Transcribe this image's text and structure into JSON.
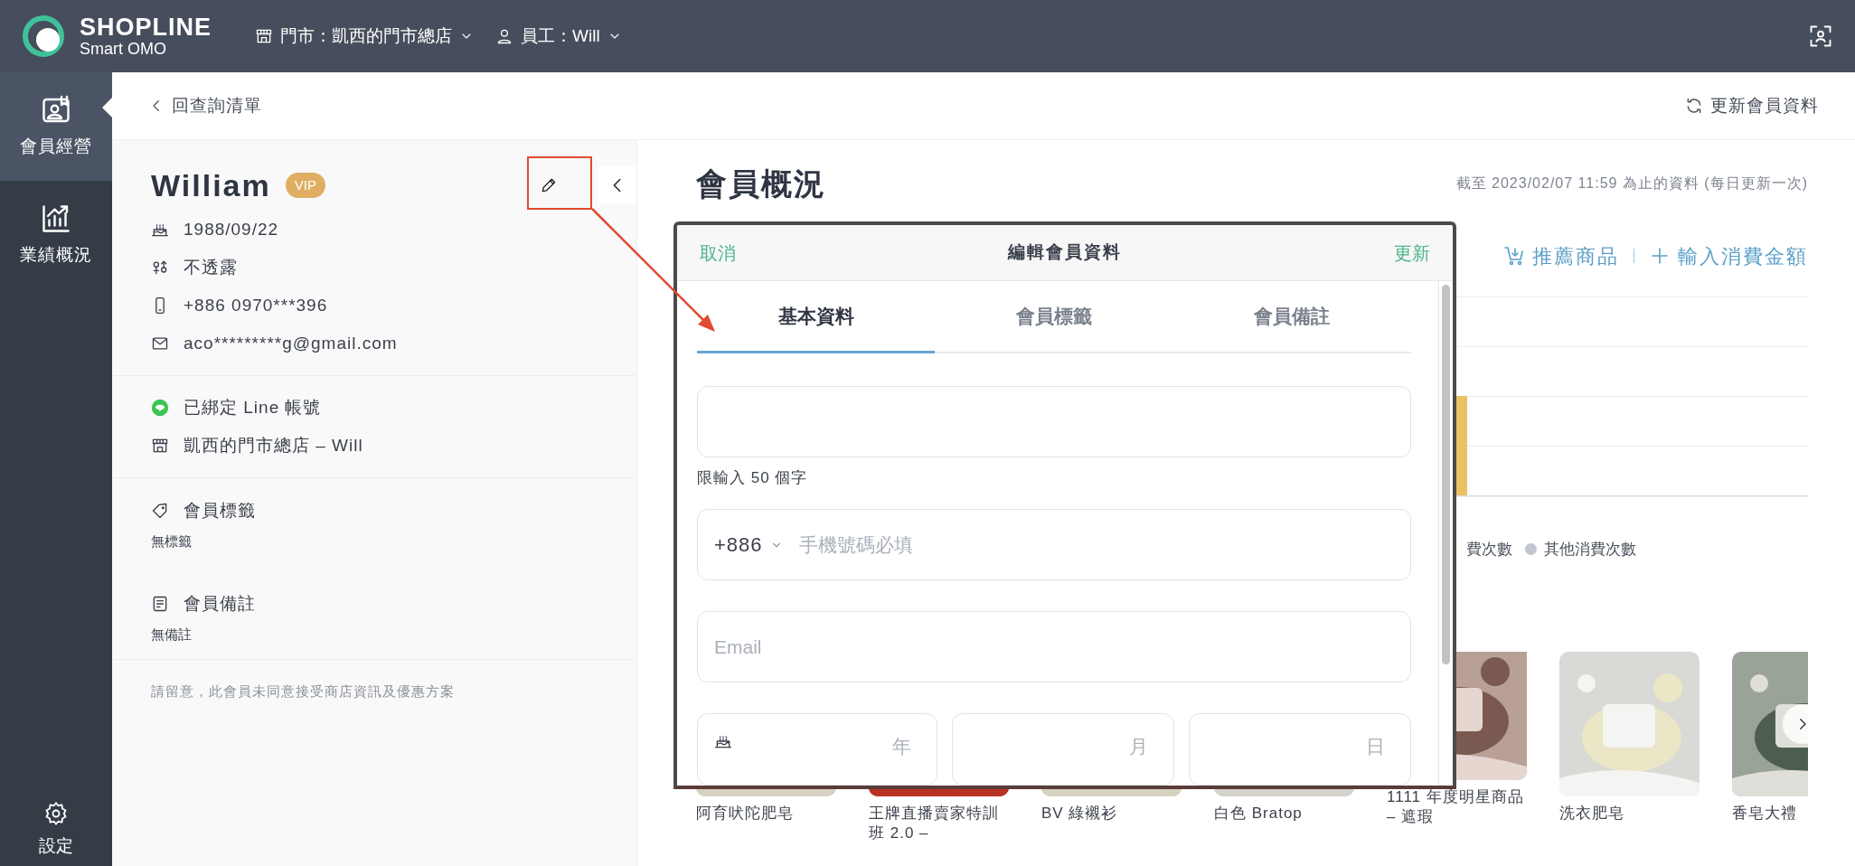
{
  "brand": {
    "name": "SHOPLINE",
    "subtitle": "Smart OMO"
  },
  "topbar": {
    "store": "門市：凱西的門市總店",
    "staff": "員工：Will"
  },
  "sidebar": {
    "items": [
      {
        "label": "會員經營",
        "selected": true
      },
      {
        "label": "業績概況",
        "selected": false
      }
    ],
    "settings": "設定"
  },
  "back_link": "回查詢清單",
  "refresh": "更新會員資料",
  "member": {
    "name": "William",
    "badge": "VIP",
    "details": [
      "1988/09/22",
      "不透露",
      "+886 0970***396",
      "aco*********g@gmail.com"
    ],
    "links": [
      "已綁定 Line 帳號",
      "凱西的門市總店 – Will"
    ],
    "sections": [
      {
        "title": "會員標籤",
        "value": "無標籤"
      },
      {
        "title": "會員備註",
        "value": "無備註"
      }
    ],
    "notice": "請留意，此會員未同意接受商店資訊及優惠方案"
  },
  "overview": {
    "title": "會員概況",
    "updated": "截至 2023/02/07 11:59 為止的資料 (每日更新一次)",
    "actions": [
      "推薦商品",
      "輸入消費金額"
    ],
    "legend": [
      {
        "label": "費次數"
      },
      {
        "label": "其他消費次數",
        "color": "#c3c5d0"
      }
    ],
    "products": [
      {
        "name": "阿育吠陀肥皂",
        "kind": "picture"
      },
      {
        "name": "王牌直播賣家特訓班 2.0 –",
        "kind": "picture"
      },
      {
        "name": "BV 綠襯衫",
        "kind": "picture"
      },
      {
        "name": "白色 Bratop",
        "kind": "picture"
      },
      {
        "name": "1111 年度明星商品 – 遮瑕",
        "kind": "picture"
      },
      {
        "name": "洗衣肥皂",
        "kind": "picture"
      },
      {
        "name": "香皂大禮",
        "kind": "picture"
      }
    ]
  },
  "modal": {
    "cancel": "取消",
    "title": "編輯會員資料",
    "submit": "更新",
    "tabs": [
      {
        "label": "基本資料",
        "selected": true
      },
      {
        "label": "會員標籤",
        "selected": false
      },
      {
        "label": "會員備註",
        "selected": false
      }
    ],
    "name_field": {
      "hint": "限輸入 50 個字"
    },
    "phone": {
      "code": "+886",
      "placeholder": "手機號碼必填"
    },
    "email": {
      "placeholder": "Email"
    },
    "birthday": [
      {
        "unit": "年"
      },
      {
        "unit": "月"
      },
      {
        "unit": "日"
      }
    ]
  }
}
